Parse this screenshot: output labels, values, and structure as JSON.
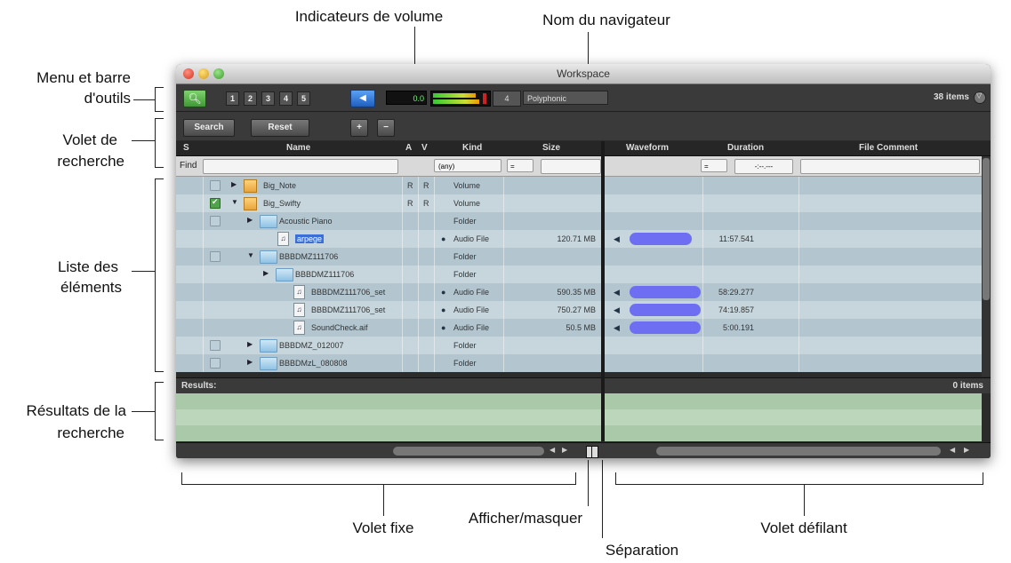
{
  "callouts": {
    "volume_meters": "Indicateurs de volume",
    "browser_name": "Nom du navigateur",
    "menu_toolbar_l1": "Menu et barre",
    "menu_toolbar_l2": "d'outils",
    "search_pane_l1": "Volet de",
    "search_pane_l2": "recherche",
    "item_list_l1": "Liste des",
    "item_list_l2": "éléments",
    "search_results_l1": "Résultats de la",
    "search_results_l2": "recherche",
    "fixed_pane": "Volet fixe",
    "show_hide": "Afficher/masquer",
    "separation": "Séparation",
    "scroll_pane": "Volet défilant"
  },
  "window": {
    "title": "Workspace",
    "toolbar": {
      "numbers": [
        "1",
        "2",
        "3",
        "4",
        "5"
      ],
      "meter_value": "0.0",
      "counter": "4",
      "mode": "Polyphonic",
      "item_count": "38 items"
    },
    "search": {
      "search_label": "Search",
      "reset_label": "Reset",
      "plus": "+",
      "minus": "−"
    },
    "columns": {
      "s": "S",
      "name": "Name",
      "a": "A",
      "v": "V",
      "kind": "Kind",
      "size": "Size",
      "waveform": "Waveform",
      "duration": "Duration",
      "comment": "File Comment"
    },
    "find": {
      "label": "Find",
      "kind_any": "(any)",
      "eq1": "=",
      "eq2": "=",
      "duration_ph": "-:--.---"
    },
    "rows": [
      {
        "indent": 0,
        "tri": "▶",
        "check": "",
        "icon": "volume",
        "name": "Big_Note",
        "a": "R",
        "v": "R",
        "kind": "Volume",
        "size": "",
        "dur": "",
        "wave": 0
      },
      {
        "indent": 0,
        "tri": "▼",
        "check": "✔",
        "icon": "volume",
        "name": "Big_Swifty",
        "a": "R",
        "v": "R",
        "kind": "Volume",
        "size": "",
        "dur": "",
        "wave": 0
      },
      {
        "indent": 1,
        "tri": "▶",
        "check": "",
        "icon": "folder",
        "name": "Acoustic Piano",
        "a": "",
        "v": "",
        "kind": "Folder",
        "size": "",
        "dur": "",
        "wave": 0
      },
      {
        "indent": 2,
        "tri": "",
        "check": "",
        "icon": "audio",
        "name": "arpege",
        "a": "",
        "v": "",
        "kind": "Audio File",
        "size": "120.71 MB",
        "dur": "11:57.541",
        "wave": 70
      },
      {
        "indent": 1,
        "tri": "▼",
        "check": "",
        "icon": "folder",
        "name": "BBBDMZ111706",
        "a": "",
        "v": "",
        "kind": "Folder",
        "size": "",
        "dur": "",
        "wave": 0
      },
      {
        "indent": 2,
        "tri": "▶",
        "check": "",
        "icon": "folder",
        "name": "BBBDMZ111706",
        "a": "",
        "v": "",
        "kind": "Folder",
        "size": "",
        "dur": "",
        "wave": 0
      },
      {
        "indent": 3,
        "tri": "",
        "check": "",
        "icon": "audio",
        "name": "BBBDMZ111706_set",
        "a": "",
        "v": "",
        "kind": "Audio File",
        "size": "590.35 MB",
        "dur": "58:29.277",
        "wave": 80
      },
      {
        "indent": 3,
        "tri": "",
        "check": "",
        "icon": "audio",
        "name": "BBBDMZ111706_set",
        "a": "",
        "v": "",
        "kind": "Audio File",
        "size": "750.27 MB",
        "dur": "74:19.857",
        "wave": 80
      },
      {
        "indent": 3,
        "tri": "",
        "check": "",
        "icon": "audio",
        "name": "SoundCheck.aif",
        "a": "",
        "v": "",
        "kind": "Audio File",
        "size": "50.5 MB",
        "dur": "5:00.191",
        "wave": 80
      },
      {
        "indent": 1,
        "tri": "▶",
        "check": "",
        "icon": "folder",
        "name": "BBBDMZ_012007",
        "a": "",
        "v": "",
        "kind": "Folder",
        "size": "",
        "dur": "",
        "wave": 0
      },
      {
        "indent": 1,
        "tri": "▶",
        "check": "",
        "icon": "folder",
        "name": "BBBDMzL_080808",
        "a": "",
        "v": "",
        "kind": "Folder",
        "size": "",
        "dur": "",
        "wave": 0
      }
    ],
    "results": {
      "label": "Results:",
      "count": "0 items"
    },
    "colors": {
      "row_a": "#b3c6d0",
      "row_b": "#c7d6dd",
      "result_a": "#a9c9a9",
      "result_b": "#bcd6bc",
      "waveform": "#6e6ef2",
      "accent_green": "#4fa34a"
    }
  }
}
